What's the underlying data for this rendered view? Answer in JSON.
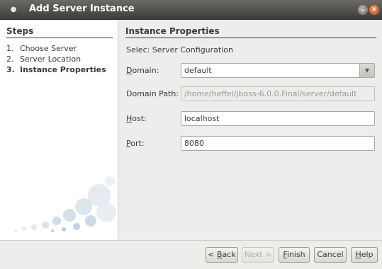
{
  "window": {
    "title": "Add Server Instance",
    "menu_icon": "window-menu-icon",
    "minimize_icon": "minimize-icon",
    "close_icon": "close-icon"
  },
  "steps": {
    "heading": "Steps",
    "items": [
      {
        "num": "1.",
        "label": "Choose Server",
        "current": false
      },
      {
        "num": "2.",
        "label": "Server Location",
        "current": false
      },
      {
        "num": "3.",
        "label": "Instance Properties",
        "current": true
      }
    ]
  },
  "main": {
    "heading": "Instance Properties",
    "subtitle": "Selec: Server Configuration",
    "domain": {
      "mnemonic": "D",
      "label_rest": "omain:",
      "value": "default"
    },
    "domain_path": {
      "label": "Domain Path:",
      "value": "/home/heffel/jboss-6.0.0.Final/server/default"
    },
    "host": {
      "mnemonic": "H",
      "label_rest": "ost:",
      "value": "localhost"
    },
    "port": {
      "mnemonic": "P",
      "label_rest": "ort:",
      "value": "8080"
    }
  },
  "buttons": {
    "back": {
      "prefix": "< ",
      "mnemonic": "B",
      "rest": "ack"
    },
    "next": {
      "label": "Next >"
    },
    "finish": {
      "mnemonic": "F",
      "rest": "inish"
    },
    "cancel": {
      "label": "Cancel"
    },
    "help": {
      "mnemonic": "H",
      "rest": "elp"
    }
  },
  "colors": {
    "titlebar": "#4a4946",
    "panel_bg": "#ededeb",
    "close_button": "#e0622b"
  }
}
